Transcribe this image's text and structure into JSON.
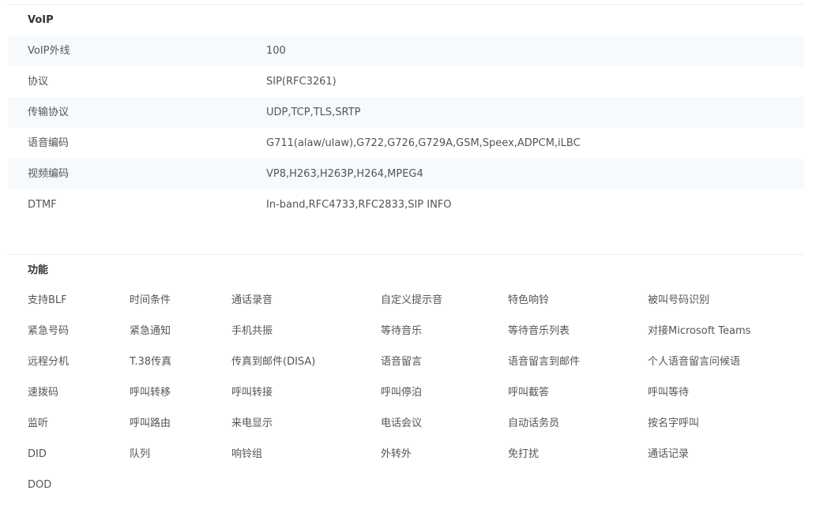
{
  "voip": {
    "title": "VoIP",
    "rows": [
      {
        "key": "VoIP外线",
        "value": "100"
      },
      {
        "key": "协议",
        "value": "SIP(RFC3261)"
      },
      {
        "key": "传输协议",
        "value": "UDP,TCP,TLS,SRTP"
      },
      {
        "key": "语音编码",
        "value": "G711(alaw/ulaw),G722,G726,G729A,GSM,Speex,ADPCM,iLBC"
      },
      {
        "key": "视频编码",
        "value": "VP8,H263,H263P,H264,MPEG4"
      },
      {
        "key": "DTMF",
        "value": "In-band,RFC4733,RFC2833,SIP INFO"
      }
    ]
  },
  "features": {
    "title": "功能",
    "rows": [
      [
        "支持BLF",
        "时间条件",
        "通话录音",
        "自定义提示音",
        "特色响铃",
        "被叫号码识别"
      ],
      [
        "紧急号码",
        "紧急通知",
        "手机共振",
        "等待音乐",
        "等待音乐列表",
        "对接Microsoft Teams"
      ],
      [
        "远程分机",
        "T.38传真",
        "传真到邮件(DISA)",
        "语音留言",
        "语音留言到邮件",
        "个人语音留言问候语"
      ],
      [
        "速拨码",
        "呼叫转移",
        "呼叫转接",
        "呼叫停泊",
        "呼叫截答",
        "呼叫等待"
      ],
      [
        "监听",
        "呼叫路由",
        "来电显示",
        "电话会议",
        "自动话务员",
        "按名字呼叫"
      ],
      [
        "DID",
        "队列",
        "响铃组",
        "外转外",
        "免打扰",
        "通话记录"
      ],
      [
        "DOD"
      ]
    ]
  }
}
